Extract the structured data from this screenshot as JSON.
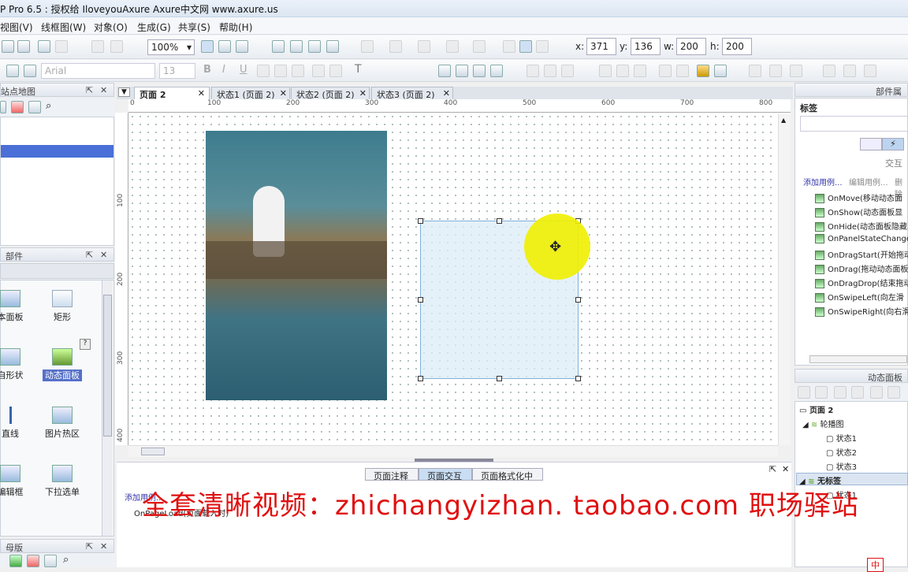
{
  "title": "P Pro 6.5 : 授权给 IloveyouAxure Axure中文网 www.axure.us",
  "menu": [
    "视图(V)",
    "线框图(W)",
    "对象(O)",
    "生成(G)",
    "共享(S)",
    "帮助(H)"
  ],
  "toolbar": {
    "zoom": "100%",
    "font": "Arial",
    "font_size": "13"
  },
  "coords": {
    "x_label": "x:",
    "x": "371",
    "y_label": "y:",
    "y": "136",
    "w_label": "w:",
    "w": "200",
    "h_label": "h:",
    "h": "200"
  },
  "sitemap": {
    "title": "站点地图"
  },
  "widgets": {
    "title": "部件",
    "items": [
      "本面板",
      "矩形",
      "自形状",
      "动态面板",
      "直线",
      "图片热区",
      "编辑框",
      "下拉选单"
    ]
  },
  "masters": {
    "title": "母版"
  },
  "tabs": [
    "页面 2",
    "状态1 (页面 2)",
    "状态2 (页面 2)",
    "状态3 (页面 2)"
  ],
  "ruler_h": [
    "0",
    "100",
    "200",
    "300",
    "400",
    "500",
    "600",
    "700",
    "800"
  ],
  "ruler_v": [
    "100",
    "200",
    "300",
    "400"
  ],
  "bottom_tabs": [
    "页面注释",
    "页面交互",
    "页面格式化中"
  ],
  "bottom": {
    "add_case": "添加用例...",
    "event": "OnPageLoad(页面载入时)"
  },
  "props": {
    "title": "部件属性",
    "label": "标签",
    "section": "交互",
    "add_case": "添加用例...",
    "edit_case": "编辑用例...",
    "delete": "删除",
    "events": [
      "OnMove(移动动态面",
      "OnShow(动态面板显",
      "OnHide(动态面板隐藏",
      "OnPanelStateChange",
      "OnDragStart(开始拖动",
      "OnDrag(拖动动态面板",
      "OnDragDrop(结束拖动",
      "OnSwipeLeft(向左滑",
      "OnSwipeRight(向右滑"
    ]
  },
  "panels": {
    "title": "动态面板管",
    "page": "页面 2",
    "panel": "轮播图",
    "states": [
      "状态1",
      "状态2",
      "状态3"
    ],
    "unlabeled": "无标签",
    "state_partial": "状态1"
  },
  "watermark": "全套清晰视频：zhichangyizhan. taobao.com 职场驿站",
  "ime": "中"
}
